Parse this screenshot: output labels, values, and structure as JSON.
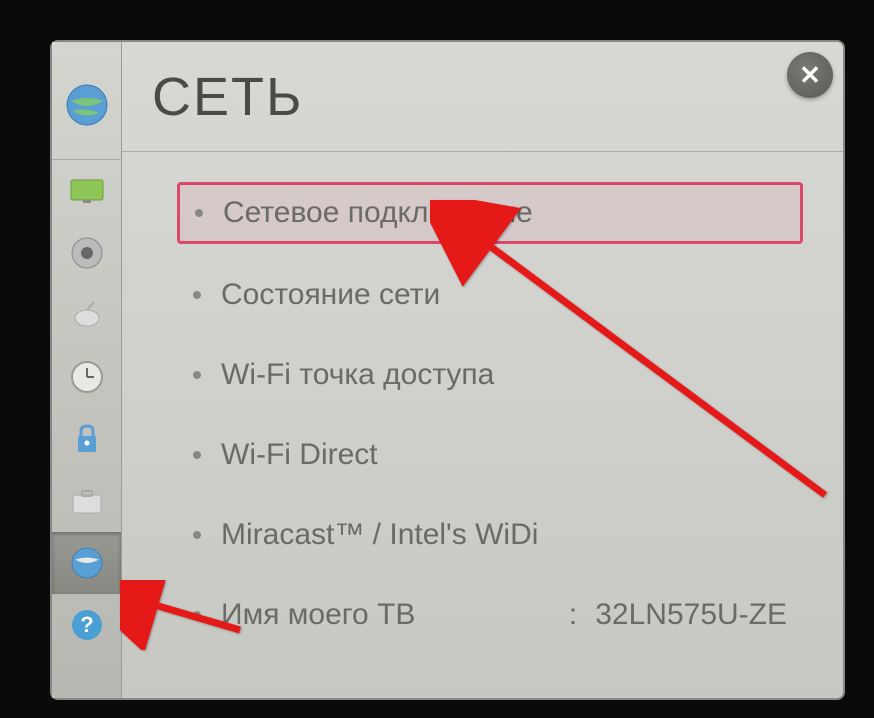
{
  "header": {
    "title": "СЕТЬ"
  },
  "menu": {
    "items": [
      {
        "label": "Сетевое подключение"
      },
      {
        "label": "Состояние сети"
      },
      {
        "label": "Wi-Fi точка доступа"
      },
      {
        "label": "Wi-Fi Direct"
      },
      {
        "label": "Miracast™ / Intel's WiDi"
      },
      {
        "label": "Имя моего ТВ",
        "value": "32LN575U-ZE"
      }
    ]
  },
  "sidebar": {
    "icons": [
      "network-globe",
      "display",
      "speaker",
      "satellite",
      "clock",
      "lock",
      "briefcase",
      "network-globe-small",
      "help"
    ]
  }
}
